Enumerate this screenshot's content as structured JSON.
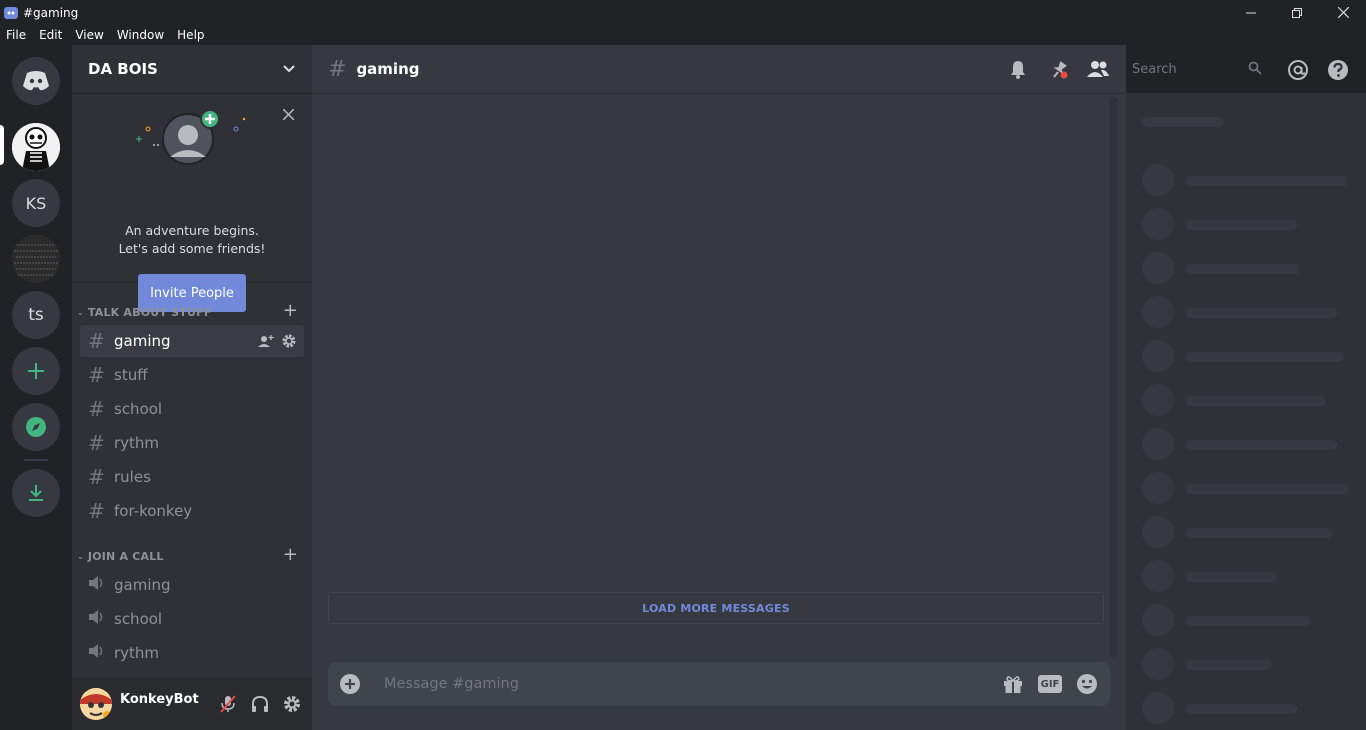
{
  "window": {
    "title": "#gaming"
  },
  "menu": [
    "File",
    "Edit",
    "View",
    "Window",
    "Help"
  ],
  "servers": {
    "ks_label": "KS",
    "ts_label": "ts"
  },
  "guild": {
    "name": "DA BOIS"
  },
  "invite_card": {
    "line1": "An adventure begins.",
    "line2": "Let's add some friends!",
    "button": "Invite People"
  },
  "categories": {
    "text": {
      "label": "TALK ABOUT STUFF",
      "channels": [
        "gaming",
        "stuff",
        "school",
        "rythm",
        "rules",
        "for-konkey"
      ]
    },
    "voice": {
      "label": "JOIN A CALL",
      "channels": [
        "gaming",
        "school",
        "rythm"
      ]
    }
  },
  "user": {
    "name": "KonkeyBot"
  },
  "chat": {
    "channel": "gaming",
    "load_more": "LOAD MORE MESSAGES",
    "placeholder": "Message #gaming",
    "gif_label": "GIF"
  },
  "search": {
    "placeholder": "Search"
  },
  "colors": {
    "accent": "#7289da",
    "green": "#43b581",
    "bg_main": "#36393f",
    "bg_sidebar": "#2f3136",
    "bg_rail": "#202225"
  }
}
